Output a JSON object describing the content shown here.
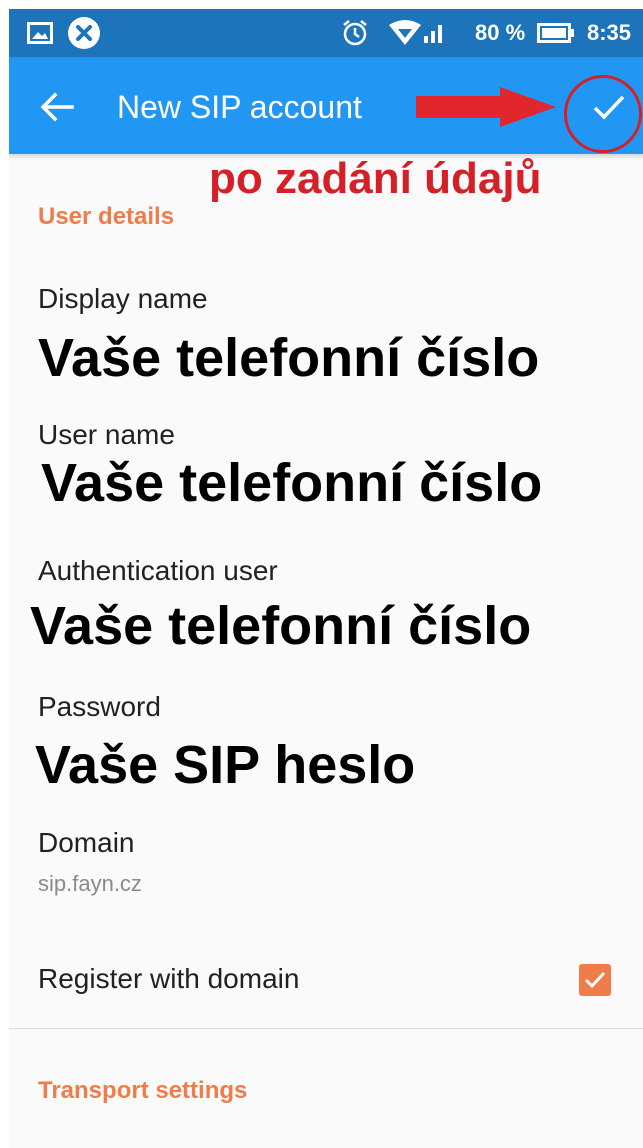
{
  "statusbar": {
    "battery_percent": "80 %",
    "time": "8:35",
    "icons": [
      "image-icon",
      "close-circle-icon",
      "alarm-icon",
      "wifi-icon",
      "signal-icon",
      "battery-icon"
    ]
  },
  "appbar": {
    "title": "New SIP account",
    "back_icon": "arrow-back-icon",
    "confirm_icon": "check-icon",
    "color": "#2196f3",
    "statusbar_color": "#1d74bb"
  },
  "annotation": {
    "text": "po zadání údajů",
    "color": "#d42027"
  },
  "user_details": {
    "heading": "User details",
    "fields": [
      {
        "label": "Display name",
        "value": "Vaše telefonní číslo"
      },
      {
        "label": "User name",
        "value": "Vaše telefonní číslo"
      },
      {
        "label": "Authentication user",
        "value": "Vaše telefonní číslo"
      },
      {
        "label": "Password",
        "value": "Vaše SIP heslo"
      }
    ],
    "domain": {
      "label": "Domain",
      "value": "sip.fayn.cz"
    },
    "register": {
      "label": "Register with domain",
      "checked": true
    }
  },
  "transport": {
    "heading": "Transport settings"
  },
  "accent_color": "#f07c4a"
}
